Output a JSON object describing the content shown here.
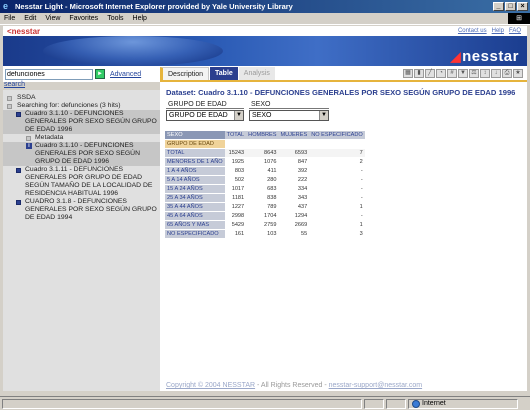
{
  "window": {
    "title": "Nesstar Light - Microsoft Internet Explorer provided by Yale University Library",
    "menu": [
      "File",
      "Edit",
      "View",
      "Favorites",
      "Tools",
      "Help"
    ]
  },
  "header": {
    "small_logo": "nesstar",
    "links": [
      "Contact us",
      "Help",
      "FAQ"
    ],
    "big_logo": "nesstar"
  },
  "search": {
    "value": "defunciones",
    "advanced_label": "Advanced",
    "search_link": "search"
  },
  "tabs": [
    {
      "label": "Description"
    },
    {
      "label": "Table"
    },
    {
      "label": "Analysis"
    }
  ],
  "sidebar": {
    "items": [
      {
        "label": "SSDA"
      },
      {
        "label": "Searching for: defunciones (3 hits)"
      },
      {
        "label": "Cuadro 3.1.10 - DEFUNCIONES GENERALES POR SEXO SEGÚN GRUPO DE EDAD 1996"
      },
      {
        "label": "Metadata"
      },
      {
        "label": "Cuadro 3.1.10 - DEFUNCIONES GENERALES POR SEXO SEGÚN GRUPO DE EDAD 1996"
      },
      {
        "label": "Cuadro 3.1.11 - DEFUNCIONES GENERALES POR GRUPO DE EDAD SEGÚN TAMAÑO DE LA LOCALIDAD DE RESIDENCIA HABITUAL 1996"
      },
      {
        "label": "CUADRO 3.1.8 - DEFUNCIONES GENERALES POR SEXO SEGÚN GRUPO DE EDAD 1994"
      }
    ]
  },
  "main": {
    "dataset_title": "Dataset: Cuadro 3.1.10 - DEFUNCIONES GENERALES POR SEXO SEGÚN GRUPO DE EDAD 1996",
    "dropdowns": [
      {
        "legend": "GRUPO DE EDAD",
        "value": "GRUPO DE EDAD"
      },
      {
        "legend": "SEXO",
        "value": "SEXO"
      }
    ],
    "table": {
      "corner": "SEXO",
      "group_label": "GRUPO DE EDAD",
      "columns": [
        "TOTAL",
        "HOMBRES",
        "MUJERES",
        "NO ESPECIFICADO"
      ],
      "rows": [
        {
          "label": "TOTAL",
          "values": [
            "15243",
            "8643",
            "6593",
            "7"
          ]
        },
        {
          "label": "MENORES DE 1 AÑO",
          "values": [
            "1925",
            "1076",
            "847",
            "2"
          ]
        },
        {
          "label": "1 A 4 AÑOS",
          "values": [
            "803",
            "411",
            "392",
            "-"
          ]
        },
        {
          "label": "5 A 14 AÑOS",
          "values": [
            "502",
            "280",
            "222",
            "-"
          ]
        },
        {
          "label": "15 A 24 AÑOS",
          "values": [
            "1017",
            "683",
            "334",
            "-"
          ]
        },
        {
          "label": "25 A 34 AÑOS",
          "values": [
            "1181",
            "838",
            "343",
            "-"
          ]
        },
        {
          "label": "35 A 44 AÑOS",
          "values": [
            "1227",
            "789",
            "437",
            "1"
          ]
        },
        {
          "label": "45 A 64 AÑOS",
          "values": [
            "2998",
            "1704",
            "1294",
            "-"
          ]
        },
        {
          "label": "65 AÑOS Y MAS",
          "values": [
            "5429",
            "2759",
            "2669",
            "1"
          ]
        },
        {
          "label": "NO ESPECIFICADO",
          "values": [
            "161",
            "103",
            "55",
            "3"
          ]
        }
      ]
    },
    "footer": {
      "copyright": "Copyright © 2004 NESSTAR",
      "rights": " - All Rights Reserved - ",
      "email": "nesstar-support@nesstar.com"
    }
  },
  "statusbar": {
    "zone": "Internet"
  }
}
